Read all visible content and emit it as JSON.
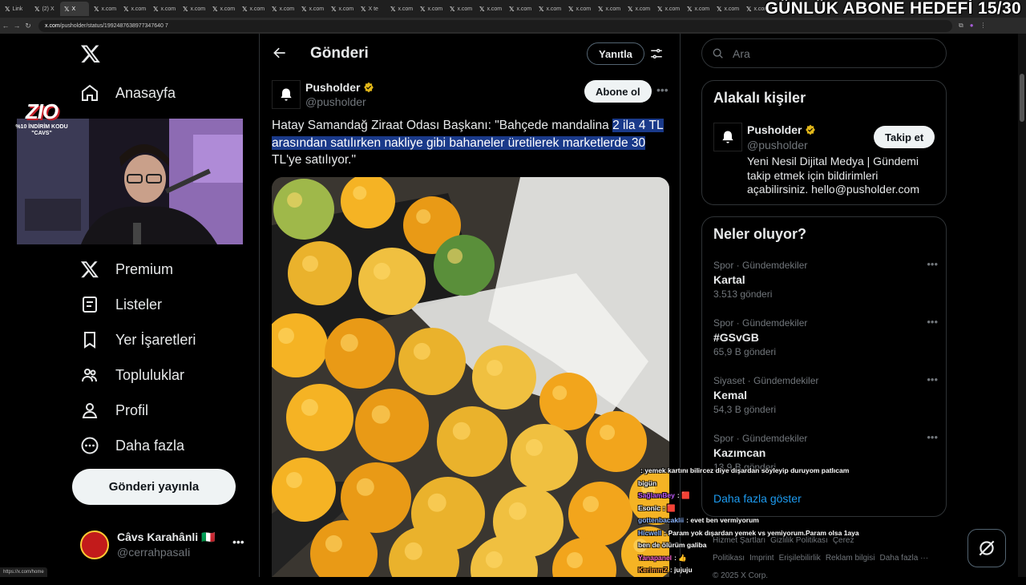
{
  "browser": {
    "tabs": [
      {
        "label": "Link",
        "active": false
      },
      {
        "label": "(2) X",
        "active": false
      },
      {
        "label": "X",
        "active": true
      },
      {
        "label": "x.com",
        "active": false
      },
      {
        "label": "x.com",
        "active": false
      },
      {
        "label": "x.com",
        "active": false
      },
      {
        "label": "x.com",
        "active": false
      },
      {
        "label": "x.com",
        "active": false
      },
      {
        "label": "x.com",
        "active": false
      },
      {
        "label": "x.com",
        "active": false
      },
      {
        "label": "x.com",
        "active": false
      },
      {
        "label": "x.com",
        "active": false
      },
      {
        "label": "X te",
        "active": false
      },
      {
        "label": "x.com",
        "active": false
      },
      {
        "label": "x.com",
        "active": false
      },
      {
        "label": "x.com",
        "active": false
      },
      {
        "label": "x.com",
        "active": false
      },
      {
        "label": "x.com",
        "active": false
      },
      {
        "label": "x.com",
        "active": false
      },
      {
        "label": "x.com",
        "active": false
      },
      {
        "label": "x.com",
        "active": false
      },
      {
        "label": "x.com",
        "active": false
      },
      {
        "label": "x.com",
        "active": false
      },
      {
        "label": "x.com",
        "active": false
      },
      {
        "label": "x.com",
        "active": false
      },
      {
        "label": "x.com",
        "active": false
      }
    ],
    "url_domain": "x.com",
    "url_path": "/pusholder/status/1992487638977347640 7",
    "status_url": "https://x.com/home"
  },
  "overlay": {
    "goal_text": "GÜNLÜK ABONE HEDEFİ 15/30",
    "zio_big": "ZIO",
    "zio_small_1": "%10 İNDİRİM KODU",
    "zio_small_2": "\"CAVS\""
  },
  "nav": {
    "home": "Anasayfa",
    "premium": "Premium",
    "lists": "Listeler",
    "bookmarks": "Yer İşaretleri",
    "communities": "Topluluklar",
    "profile": "Profil",
    "more": "Daha fazla",
    "post_button": "Gönderi yayınla"
  },
  "user": {
    "name": "Câvs Karahânli 🇮🇹",
    "handle": "@cerrahpasaIi"
  },
  "post_page": {
    "title": "Gönderi",
    "reply_label": "Yanıtla",
    "author_name": "Pusholder",
    "author_handle": "@pusholder",
    "subscribe_label": "Abone ol",
    "text_plain": "Hatay Samandağ Ziraat Odası Başkanı: \"Bahçede mandalina ",
    "text_highlighted": "2 ila 4 TL arasından satılırken nakliye gibi bahaneler üretilerek marketlerde 30",
    "text_tail": " TL'ye satılıyor.\""
  },
  "search": {
    "placeholder": "Ara"
  },
  "related": {
    "title": "Alakalı kişiler",
    "name": "Pusholder",
    "handle": "@pusholder",
    "follow_label": "Takip et",
    "bio": "Yeni Nesil Dijital Medya | Gündemi takip etmek için bildirimleri açabilirsiniz. hello@pusholder.com"
  },
  "trends": {
    "title": "Neler oluyor?",
    "items": [
      {
        "meta": "Spor · Gündemdekiler",
        "name": "Kartal",
        "count": "3.513 gönderi"
      },
      {
        "meta": "Spor · Gündemdekiler",
        "name": "#GSvGB",
        "count": "65,9 B gönderi"
      },
      {
        "meta": "Siyaset · Gündemdekiler",
        "name": "Kemal",
        "count": "54,3 B gönderi"
      },
      {
        "meta": "Spor · Gündemdekiler",
        "name": "Kazımcan",
        "count": "13,9 B gönderi"
      }
    ],
    "show_more": "Daha fazla göster"
  },
  "footer": {
    "links": [
      "Hizmet Şartları",
      "Gizlilik Politikası",
      "Çerez Politikası",
      "Imprint",
      "Erişilebilirlik",
      "Reklam bilgisi",
      "Daha fazla ···"
    ],
    "copyright": "© 2025 X Corp."
  },
  "chat": [
    {
      "user": "",
      "color": "#ff4444",
      "text": ": yemek kartını bilircez diye dışardan söyleyip duruyom patlıcam bigün"
    },
    {
      "user": "SağlamBey",
      "color": "#c45cff",
      "text": ": 🟥"
    },
    {
      "user": "Esonic",
      "color": "#ffffff",
      "text": ": 🟥"
    },
    {
      "user": "gottenbacaklii",
      "color": "#8ab4ff",
      "text": ": evet ben vermiyorum"
    },
    {
      "user": "Hicwell",
      "color": "#8ab4ff",
      "text": ": Param yok dışardan yemek vs yemiyorum.Param olsa 1aya ben de ölürüm galiba"
    },
    {
      "user": "Yanapanel",
      "color": "#ff66cc",
      "text": ": 👍"
    },
    {
      "user": "KerimmZ",
      "color": "#ff9933",
      "text": ": jujuju"
    }
  ]
}
